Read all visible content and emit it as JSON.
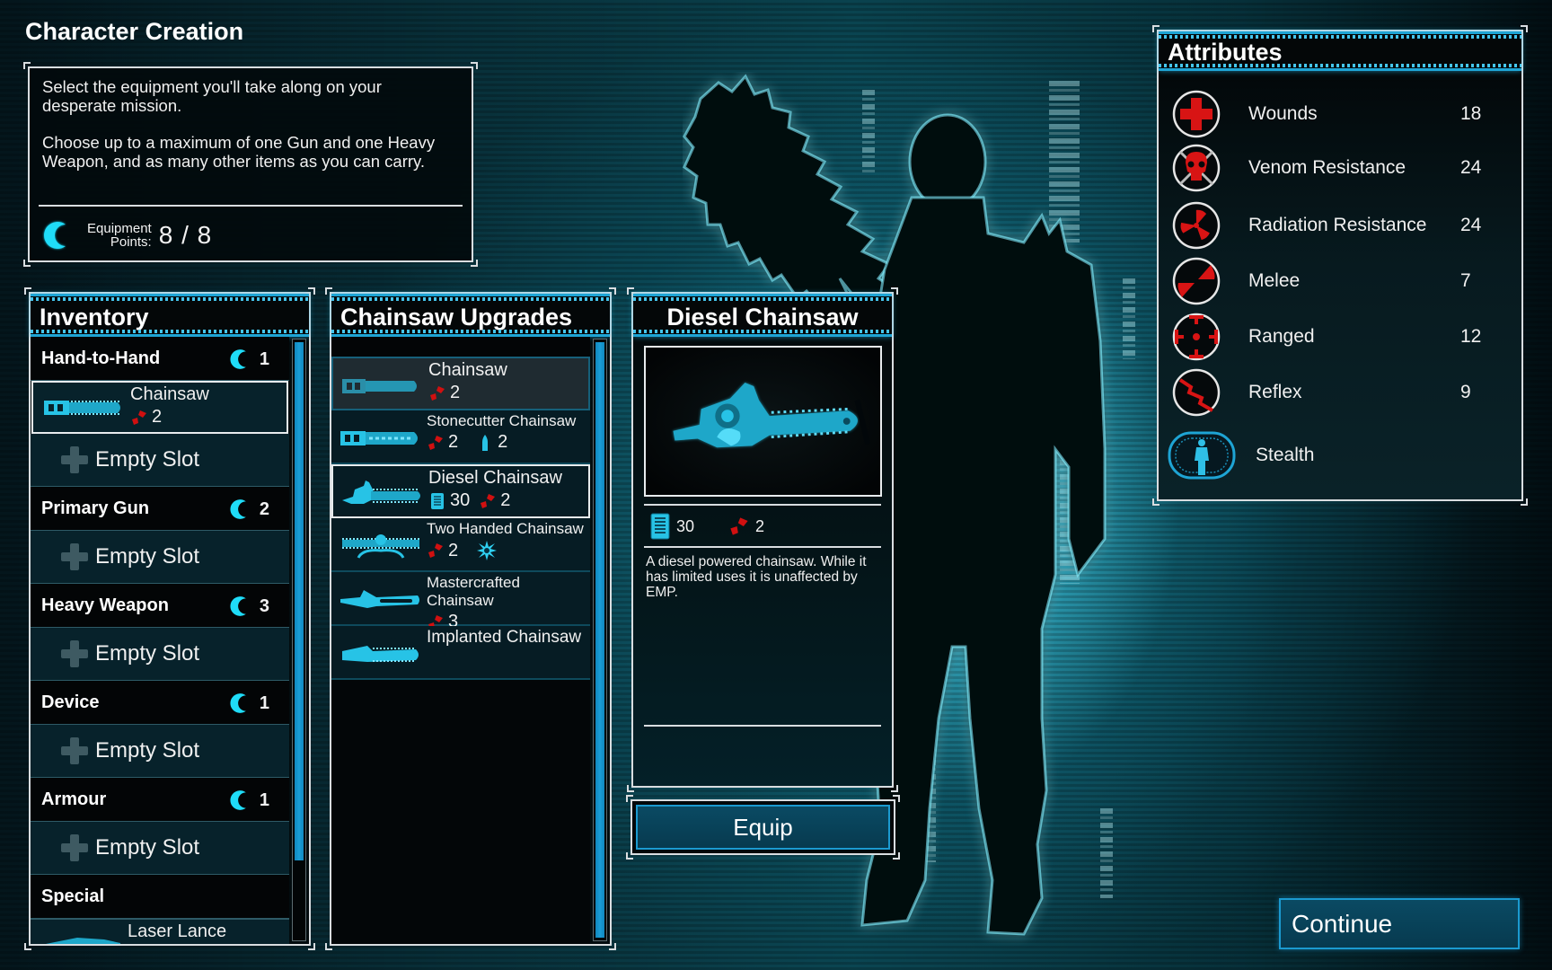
{
  "screen": {
    "title": "Character Creation"
  },
  "intro": {
    "paragraph1": "Select the equipment you'll take along on your desperate mission.",
    "paragraph2": "Choose up to a maximum of one Gun and one Heavy Weapon, and as many other items as you can carry.",
    "equipment_points_label_line1": "Equipment",
    "equipment_points_label_line2": "Points:",
    "equipment_points_value": "8 / 8",
    "equipment_points_icon": "equipment-point-icon"
  },
  "inventory": {
    "header": "Inventory",
    "scroll_visible_fraction": 0.87,
    "categories": [
      {
        "label": "Hand-to-Hand",
        "cost": "1",
        "item": {
          "name": "Chainsaw",
          "damage": "2",
          "icon": "chainsaw-icon"
        }
      },
      {
        "label": "Primary Gun",
        "cost": "2",
        "slot_label": "Empty Slot"
      },
      {
        "label": "Heavy Weapon",
        "cost": "3",
        "slot_label": "Empty Slot"
      },
      {
        "label": "Device",
        "cost": "1",
        "slot_label": "Empty Slot"
      },
      {
        "label": "Armour",
        "cost": "1",
        "slot_label": "Empty Slot"
      },
      {
        "label": "Special",
        "item": {
          "name": "Laser Lance",
          "icon": "laser-lance-icon"
        }
      }
    ],
    "hand_empty_slot_label": "Empty Slot"
  },
  "upgrades": {
    "header": "Chainsaw Upgrades",
    "scroll_visible_fraction": 1.0,
    "items": [
      {
        "name": "Chainsaw",
        "damage": "2",
        "state": "hover"
      },
      {
        "name": "Stonecutter Chainsaw",
        "damage": "2",
        "armour_piercing": "2",
        "state": "normal"
      },
      {
        "name": "Diesel Chainsaw",
        "uses": "30",
        "damage": "2",
        "state": "selected"
      },
      {
        "name": "Two Handed Chainsaw",
        "damage": "2",
        "special_icon": "burst-icon",
        "state": "normal"
      },
      {
        "name": "Mastercrafted Chainsaw",
        "damage": "3",
        "state": "normal"
      },
      {
        "name": "Implanted Chainsaw",
        "state": "normal"
      }
    ]
  },
  "detail": {
    "header": "Diesel Chainsaw",
    "uses": "30",
    "damage": "2",
    "description": "A diesel powered chainsaw. While it has limited uses it is unaffected by EMP.",
    "equip_label": "Equip"
  },
  "attributes": {
    "header": "Attributes",
    "rows": [
      {
        "label": "Wounds",
        "value": "18",
        "icon": "wounds-cross-icon"
      },
      {
        "label": "Venom Resistance",
        "value": "24",
        "icon": "venom-skull-icon"
      },
      {
        "label": "Radiation Resistance",
        "value": "24",
        "icon": "radiation-icon"
      },
      {
        "label": "Melee",
        "value": "7",
        "icon": "melee-icon"
      },
      {
        "label": "Ranged",
        "value": "12",
        "icon": "ranged-crosshair-icon"
      },
      {
        "label": "Reflex",
        "value": "9",
        "icon": "reflex-zigzag-icon"
      },
      {
        "label": "Stealth",
        "value": "",
        "icon": "stealth-figure-icon"
      }
    ]
  },
  "footer": {
    "continue_label": "Continue"
  },
  "colors": {
    "accent_cyan": "#1ea4d4",
    "points_cyan": "#19d6f5",
    "damage_red": "#d01010",
    "button_fill": "#0a4a63"
  }
}
